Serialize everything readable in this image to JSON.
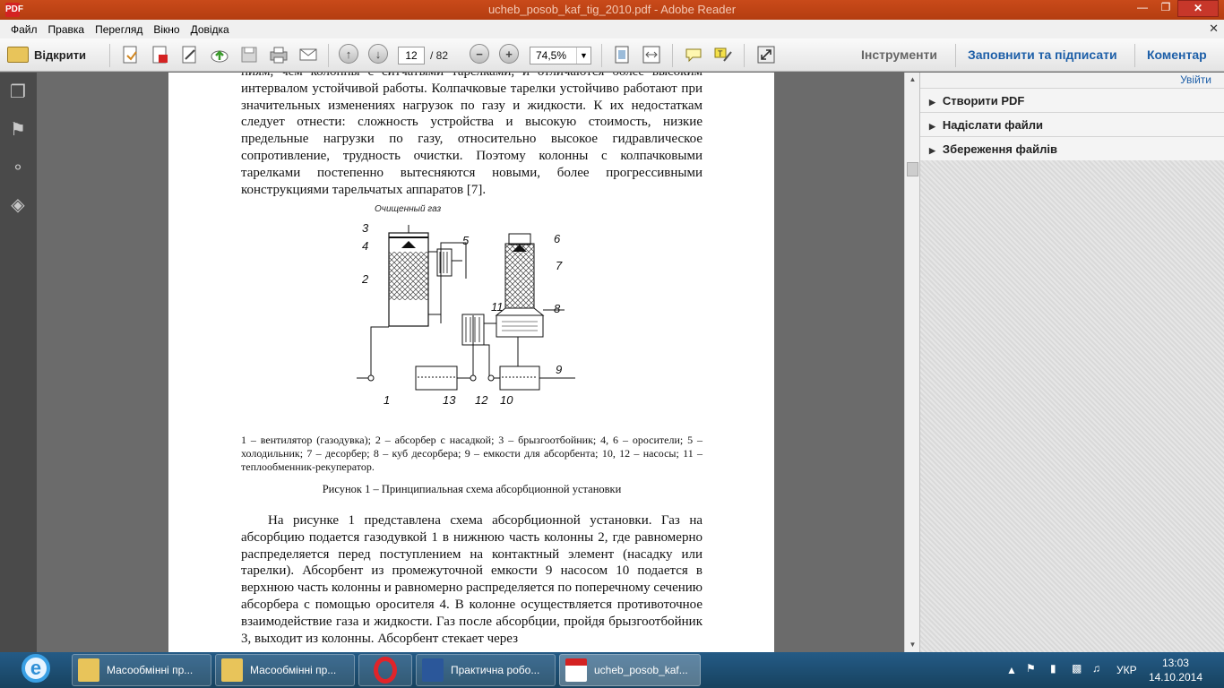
{
  "window": {
    "title": "ucheb_posob_kaf_tig_2010.pdf - Adobe Reader",
    "icon_label": "PDF"
  },
  "menu": [
    "Файл",
    "Правка",
    "Перегляд",
    "Вікно",
    "Довідка"
  ],
  "toolbar": {
    "open_label": "Відкрити",
    "page_current": "12",
    "page_total": "/ 82",
    "zoom": "74,5%",
    "tools_label": "Інструменти",
    "fill_sign_label": "Заповнити та підписати",
    "comment_label": "Коментар"
  },
  "right_panel": {
    "signin": "Увійти",
    "items": [
      "Створити PDF",
      "Надіслати файли",
      "Збереження файлів"
    ]
  },
  "document": {
    "para1": "ниям, чем колонны с ситчатыми тарелками, и отличаются более высоким интервалом устойчивой работы. Колпачковые тарелки устойчиво работают при значительных изменениях нагрузок по газу и жидкости. К их недостаткам следует отнести: сложность устройства и высокую стоимость, низкие предельные нагрузки по газу, относительно высокое гидравлическое сопротивление, трудность очистки. Поэтому колонны с колпачковыми тарелками постепенно вытесняются новыми, более прогрессивными конструкциями тарельчатых аппаратов [7].",
    "figure_gas_label": "Очищенный газ",
    "figure_numbers": [
      "1",
      "2",
      "3",
      "4",
      "5",
      "6",
      "7",
      "8",
      "9",
      "10",
      "11",
      "12",
      "13"
    ],
    "caption": "1 – вентилятор (газодувка); 2 – абсорбер с насадкой; 3 – брызгоотбойник; 4, 6 – оросители; 5 – холодильник; 7 – десорбер; 8 – куб десорбера; 9 – емкости для абсорбента; 10, 12 – насосы; 11 – теплообменник-рекуператор.",
    "figure_title": "Рисунок 1 – Принципиальная схема абсорбционной установки",
    "para2": "На рисунке 1 представлена схема абсорбционной установки. Газ на абсорбцию подается газодувкой 1 в нижнюю часть колонны 2, где равномерно распределяется перед поступлением на контактный элемент (насадку или тарелки). Абсорбент из промежуточной емкости 9 насосом 10 подается в верхнюю часть колонны и равномерно распределяется по поперечному сечению абсорбера с помощью оросителя 4. В колонне осуществляется противоточное взаимодействие газа и жидкости. Газ после абсорбции, пройдя брызгоотбойник 3, выходит из колонны. Абсорбент стекает через"
  },
  "taskbar": {
    "items": [
      "Масообмінні пр...",
      "Масообмінні пр...",
      "Практична робо...",
      "ucheb_posob_kaf..."
    ],
    "lang": "УКР",
    "time": "13:03",
    "date": "14.10.2014"
  },
  "colors": {
    "title_bar": "#c24516",
    "taskbar": "#1f5079",
    "link": "#1d5fa8"
  }
}
